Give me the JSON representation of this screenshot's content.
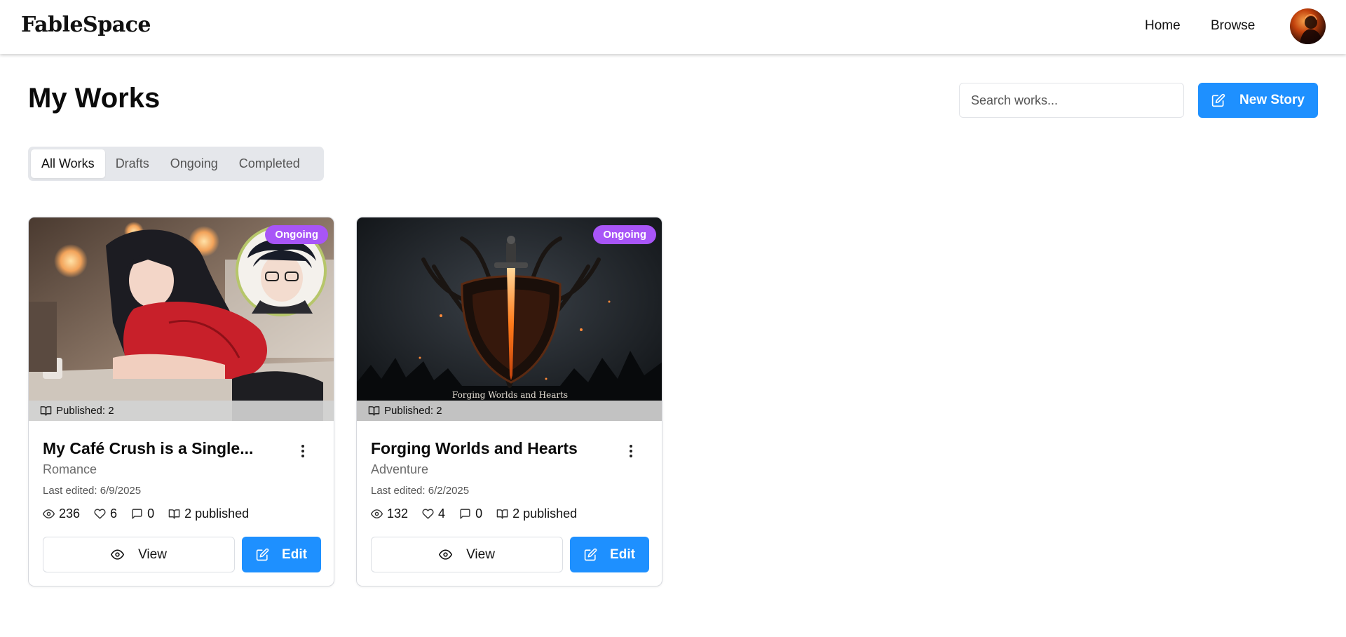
{
  "app": {
    "brand": "FableSpace",
    "nav": {
      "home": "Home",
      "browse": "Browse"
    }
  },
  "header": {
    "title": "My Works",
    "search_placeholder": "Search works...",
    "new_story_label": "New Story"
  },
  "tabs": [
    "All Works",
    "Drafts",
    "Ongoing",
    "Completed"
  ],
  "active_tab": "All Works",
  "colors": {
    "primary": "#1e90ff",
    "badge_ongoing": "#a855f7"
  },
  "works": [
    {
      "title": "My Café Crush is a Single...",
      "genre": "Romance",
      "status": "Ongoing",
      "published_strip": "Published: 2",
      "last_edited": "Last edited: 6/9/2025",
      "views": "236",
      "likes": "6",
      "comments": "0",
      "published": "2 published",
      "view_label": "View",
      "edit_label": "Edit"
    },
    {
      "title": "Forging Worlds and Hearts",
      "genre": "Adventure",
      "status": "Ongoing",
      "published_strip": "Published: 2",
      "cover_text": "Forging Worlds and Hearts",
      "last_edited": "Last edited: 6/2/2025",
      "views": "132",
      "likes": "4",
      "comments": "0",
      "published": "2 published",
      "view_label": "View",
      "edit_label": "Edit"
    }
  ]
}
